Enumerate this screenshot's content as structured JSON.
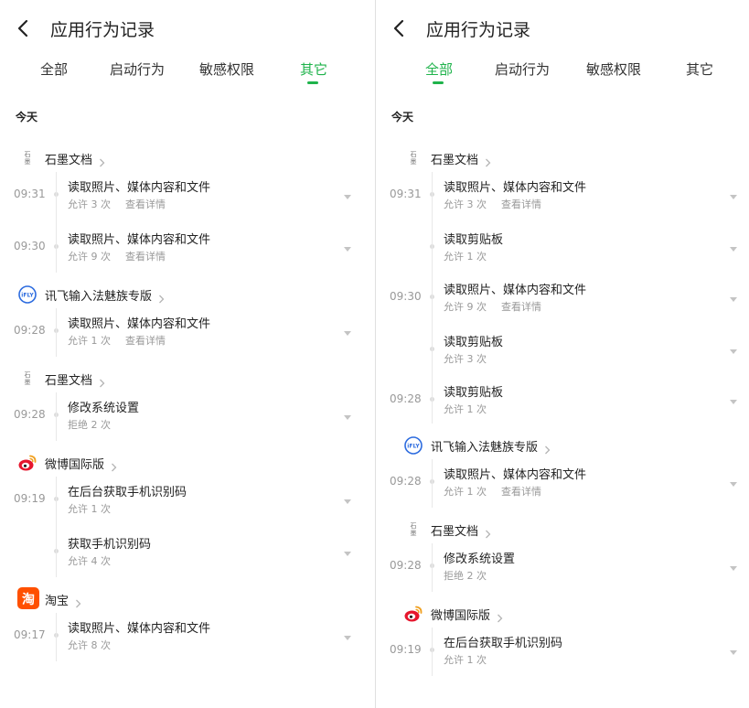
{
  "title": "应用行为记录",
  "tabs": [
    "全部",
    "启动行为",
    "敏感权限",
    "其它"
  ],
  "section_today": "今天",
  "detail_link": "查看详情",
  "colors": {
    "accent": "#1fb34b",
    "taobao": "#ff5000",
    "iflytek": "#2d6cdf",
    "weibo": "#e6162d"
  },
  "icons": {
    "shimo": "石墨",
    "iflytek": "iFLY",
    "taobao": "淘"
  },
  "left": {
    "active_tab": 3,
    "apps": [
      {
        "name": "石墨文档",
        "icon": "shimo",
        "entries": [
          {
            "time": "09:31",
            "action": "读取照片、媒体内容和文件",
            "status": "允许 3 次",
            "detail": true
          },
          {
            "time": "09:30",
            "action": "读取照片、媒体内容和文件",
            "status": "允许 9 次",
            "detail": true
          }
        ]
      },
      {
        "name": "讯飞输入法魅族专版",
        "icon": "iflytek",
        "entries": [
          {
            "time": "09:28",
            "action": "读取照片、媒体内容和文件",
            "status": "允许 1 次",
            "detail": true
          }
        ]
      },
      {
        "name": "石墨文档",
        "icon": "shimo",
        "entries": [
          {
            "time": "09:28",
            "action": "修改系统设置",
            "status": "拒绝 2 次",
            "detail": false
          }
        ]
      },
      {
        "name": "微博国际版",
        "icon": "weibo",
        "entries": [
          {
            "time": "09:19",
            "action": "在后台获取手机识别码",
            "status": "允许 1 次",
            "detail": false
          },
          {
            "time": "",
            "action": "获取手机识别码",
            "status": "允许 4 次",
            "detail": false
          }
        ]
      },
      {
        "name": "淘宝",
        "icon": "taobao",
        "entries": [
          {
            "time": "09:17",
            "action": "读取照片、媒体内容和文件",
            "status": "允许 8 次",
            "detail": false
          }
        ]
      }
    ]
  },
  "right": {
    "active_tab": 0,
    "apps": [
      {
        "name": "石墨文档",
        "icon": "shimo",
        "entries": [
          {
            "time": "09:31",
            "action": "读取照片、媒体内容和文件",
            "status": "允许 3 次",
            "detail": true
          },
          {
            "time": "",
            "action": "读取剪贴板",
            "status": "允许 1 次",
            "detail": false
          },
          {
            "time": "09:30",
            "action": "读取照片、媒体内容和文件",
            "status": "允许 9 次",
            "detail": true
          },
          {
            "time": "",
            "action": "读取剪贴板",
            "status": "允许 3 次",
            "detail": false
          },
          {
            "time": "09:28",
            "action": "读取剪贴板",
            "status": "允许 1 次",
            "detail": false
          }
        ]
      },
      {
        "name": "讯飞输入法魅族专版",
        "icon": "iflytek",
        "entries": [
          {
            "time": "09:28",
            "action": "读取照片、媒体内容和文件",
            "status": "允许 1 次",
            "detail": true
          }
        ]
      },
      {
        "name": "石墨文档",
        "icon": "shimo",
        "entries": [
          {
            "time": "09:28",
            "action": "修改系统设置",
            "status": "拒绝 2 次",
            "detail": false
          }
        ]
      },
      {
        "name": "微博国际版",
        "icon": "weibo",
        "entries": [
          {
            "time": "09:19",
            "action": "在后台获取手机识别码",
            "status": "允许 1 次",
            "detail": false
          }
        ]
      }
    ]
  }
}
